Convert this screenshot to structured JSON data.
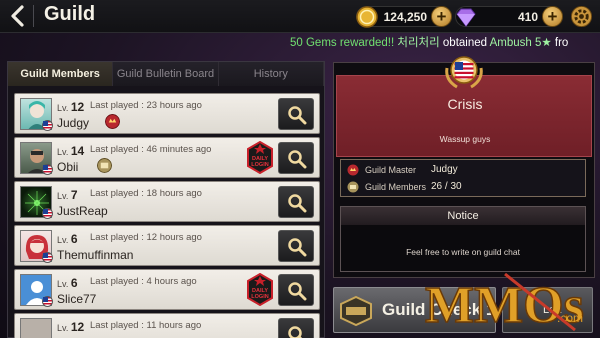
{
  "header": {
    "title": "Guild",
    "gold": "124,250",
    "gems": "410"
  },
  "ticker": {
    "part1": "50 Gems rewarded!! ",
    "name": "처리처리",
    "part2": " obtained ",
    "item": "Ambush 5★",
    "part3": " fro"
  },
  "tabs": [
    "Guild Members",
    "Guild Bulletin Board",
    "History"
  ],
  "members": [
    {
      "lv_label": "Lv.",
      "level": "12",
      "last_played": "Last played : 23 hours ago",
      "name": "Judgy",
      "daily_login": false
    },
    {
      "lv_label": "Lv.",
      "level": "14",
      "last_played": "Last played : 46 minutes ago",
      "name": "Obii",
      "daily_login": true
    },
    {
      "lv_label": "Lv.",
      "level": "7",
      "last_played": "Last played : 18 hours ago",
      "name": "JustReap",
      "daily_login": false
    },
    {
      "lv_label": "Lv.",
      "level": "6",
      "last_played": "Last played : 12 hours ago",
      "name": "Themuffinman",
      "daily_login": false
    },
    {
      "lv_label": "Lv.",
      "level": "6",
      "last_played": "Last played : 4 hours ago",
      "name": "Slice77",
      "daily_login": true
    },
    {
      "lv_label": "Lv.",
      "level": "12",
      "last_played": "Last played : 11 hours ago",
      "name": "",
      "daily_login": false
    }
  ],
  "daily_badge": {
    "line1": "DAILY",
    "line2": "LOGIN"
  },
  "guild": {
    "name": "Crisis",
    "description": "Wassup guys",
    "master_label": "Guild Master",
    "master_value": "Judgy",
    "members_label": "Guild Members",
    "members_value": "26 / 30"
  },
  "notice": {
    "title": "Notice",
    "text": "Feel free to write on guild chat"
  },
  "buttons": {
    "guild_check": "Guild Check",
    "guild_check_count": "1",
    "leave": "Lea"
  },
  "watermark": "MMOs",
  "watermark_domain": ".com",
  "colors": {
    "guild_header": "#7d252e",
    "gold_plus": "#d9a548",
    "ticker_green": "#71e070"
  }
}
